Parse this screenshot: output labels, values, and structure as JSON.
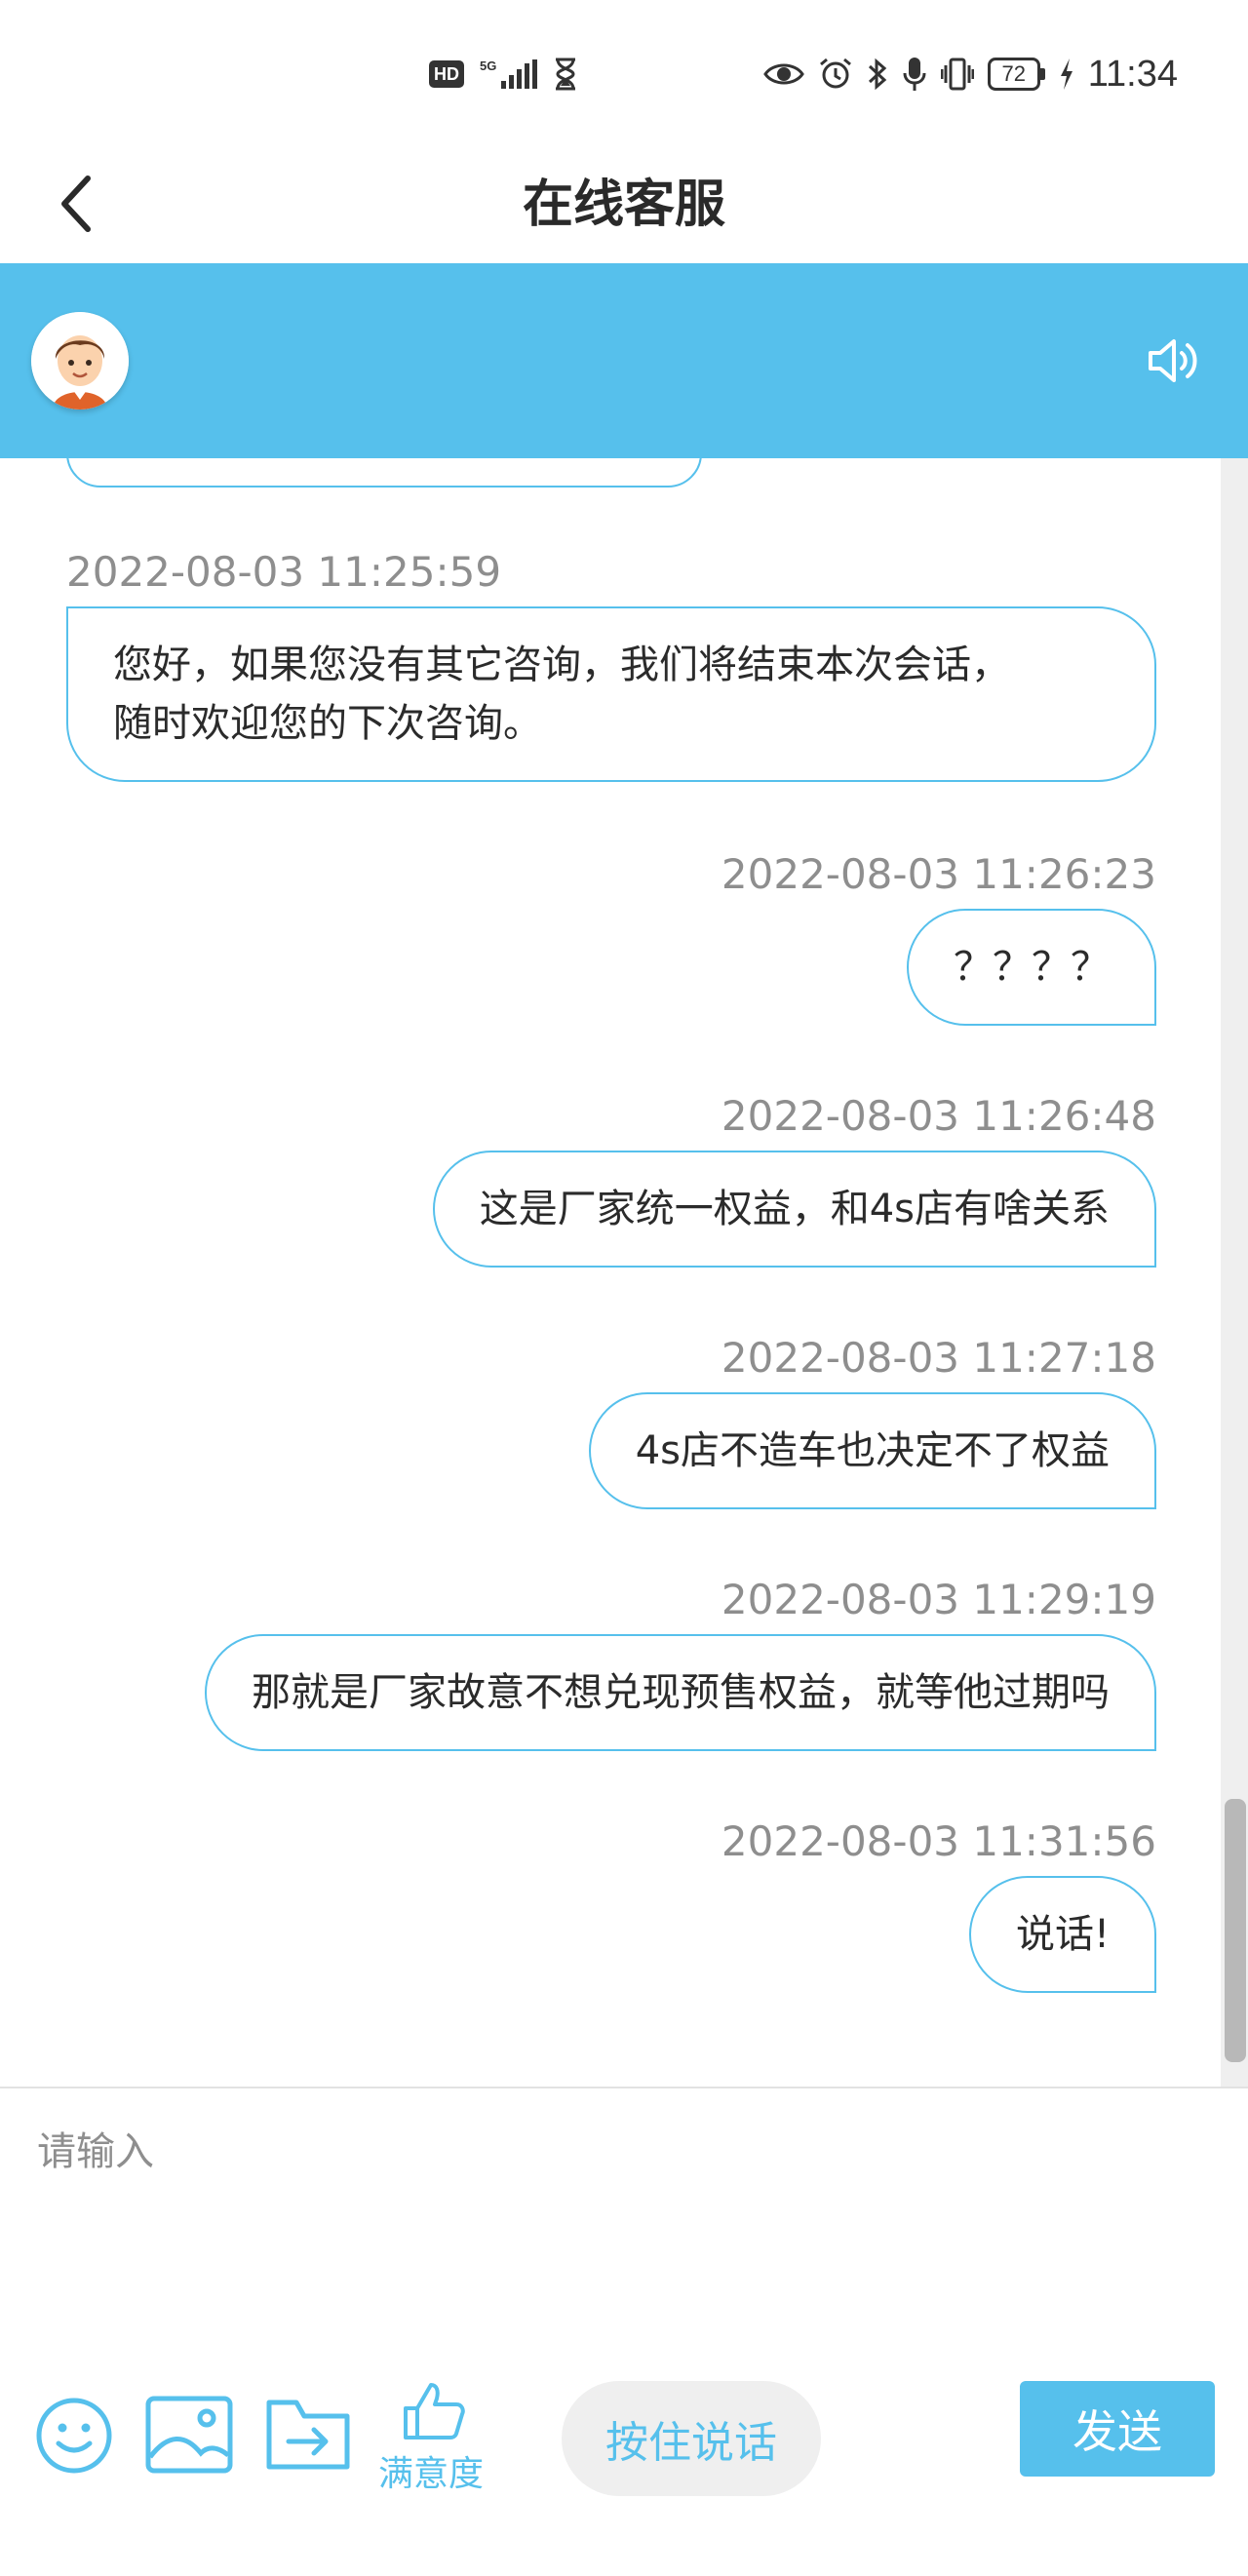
{
  "status_bar": {
    "left_badge": "HD",
    "network": "5G",
    "battery": "72",
    "time": "11:34",
    "icons": [
      "hd-icon",
      "signal-5g-icon",
      "hourglass-icon",
      "eye-icon",
      "alarm-icon",
      "bluetooth-icon",
      "microphone-icon",
      "vibrate-icon",
      "battery-icon",
      "charging-icon"
    ]
  },
  "header": {
    "title": "在线客服",
    "back_icon": "chevron-left-icon"
  },
  "agent_bar": {
    "color": "#56c0ec",
    "avatar_icon": "agent-avatar-icon",
    "speaker_icon": "speaker-icon"
  },
  "messages": [
    {
      "side": "left",
      "time": "2022-08-03 11:25:59",
      "text_lines": [
        "您好，如果您没有其它咨询，我们将结束本次会话，",
        "随时欢迎您的下次咨询。"
      ]
    },
    {
      "side": "right",
      "time": "2022-08-03 11:26:23",
      "text": "？？？？"
    },
    {
      "side": "right",
      "time": "2022-08-03 11:26:48",
      "text": "这是厂家统一权益，和4s店有啥关系"
    },
    {
      "side": "right",
      "time": "2022-08-03 11:27:18",
      "text": "4s店不造车也决定不了权益"
    },
    {
      "side": "right",
      "time": "2022-08-03 11:29:19",
      "text": "那就是厂家故意不想兑现预售权益，就等他过期吗"
    },
    {
      "side": "right",
      "time": "2022-08-03 11:31:56",
      "text": "说话!"
    }
  ],
  "input": {
    "placeholder": "请输入"
  },
  "toolbar": {
    "emoji_icon": "emoji-icon",
    "image_icon": "image-icon",
    "file_icon": "file-transfer-icon",
    "satisfaction_icon": "thumbs-up-icon",
    "satisfaction_label": "满意度",
    "hold_to_talk_label": "按住说话",
    "send_label": "发送"
  },
  "colors": {
    "accent": "#56c0ec",
    "timestamp": "#8e8e8e"
  }
}
